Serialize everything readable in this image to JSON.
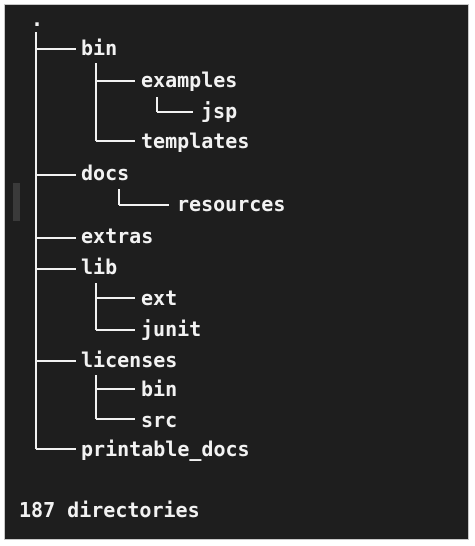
{
  "tree": {
    "root": ".",
    "entries": [
      "bin",
      "examples",
      "jsp",
      "templates",
      "docs",
      "resources",
      "extras",
      "lib",
      "ext",
      "junit",
      "licenses",
      "bin",
      "src",
      "printable_docs"
    ],
    "summary": "187 directories"
  },
  "colors": {
    "background": "#1e1e1e",
    "text": "#f2f2f2"
  }
}
